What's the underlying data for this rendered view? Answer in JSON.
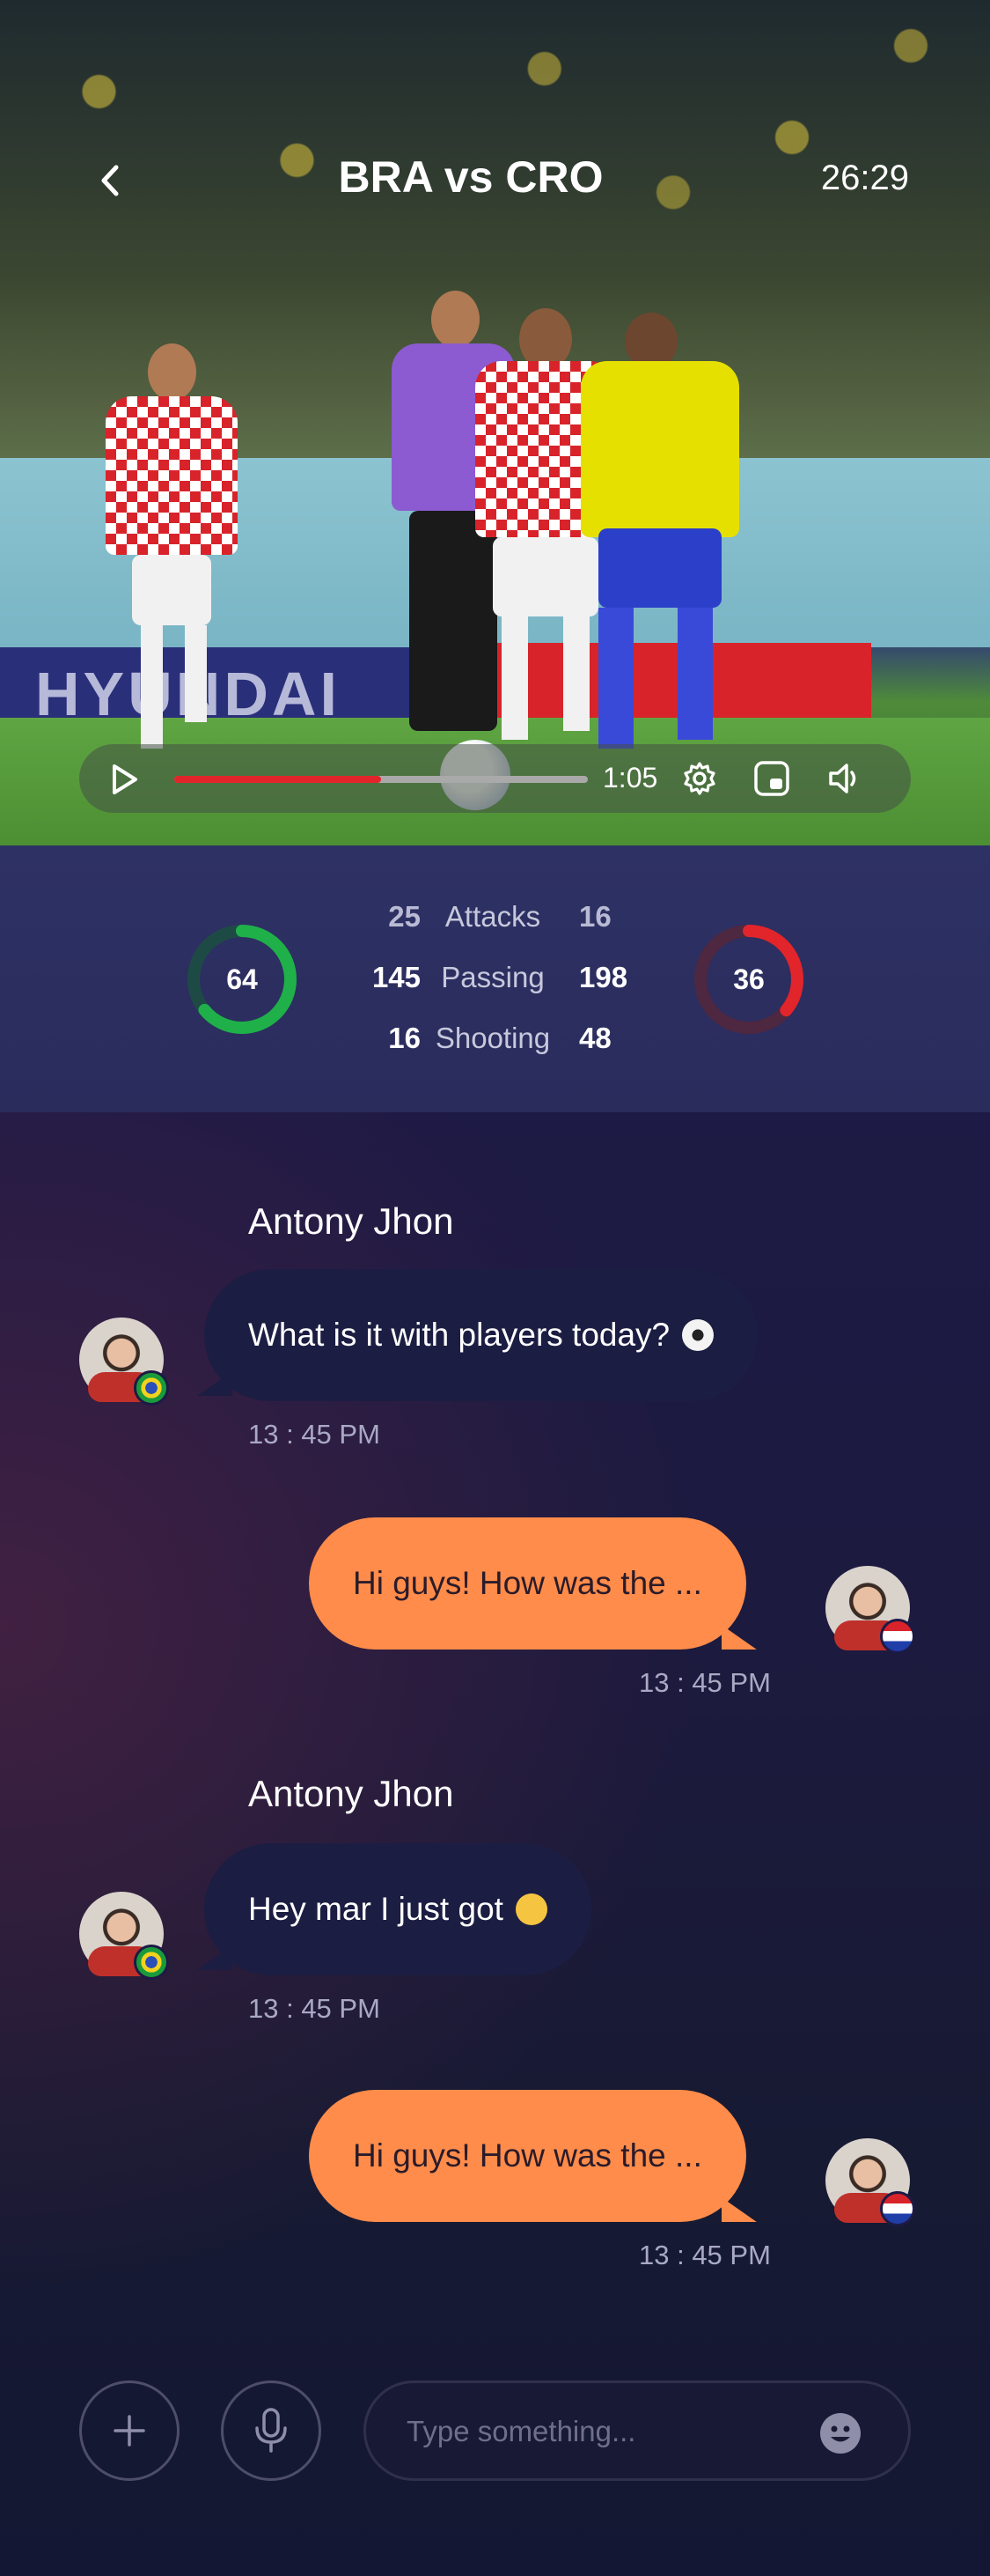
{
  "header": {
    "title": "BRA vs CRO",
    "clock": "26:29"
  },
  "video": {
    "ad_text": "HYUNDAI",
    "time": "1:05",
    "progress": 0.5,
    "colors": {
      "progress_fill": "#e1252b",
      "progress_track": "#a9a9a9"
    }
  },
  "stats": {
    "left_possession": "64",
    "right_possession": "36",
    "left_possession_fraction": 0.64,
    "right_possession_fraction": 0.36,
    "rows": [
      {
        "left": "25",
        "label": "Attacks",
        "right": "16"
      },
      {
        "left": "145",
        "label": "Passing",
        "right": "198"
      },
      {
        "left": "16",
        "label": "Shooting",
        "right": "48"
      }
    ],
    "colors": {
      "left_ring": "#1fb04a",
      "right_ring": "#e1252b"
    }
  },
  "chat": {
    "messages": [
      {
        "direction": "in",
        "sender": "Antony Jhon",
        "text": "What is it with players today?",
        "emoji": "soccer-ball",
        "time": "13 : 45 PM",
        "flag": "brazil"
      },
      {
        "direction": "out",
        "text": "Hi guys! How was the ...",
        "time": "13 : 45 PM",
        "flag": "croatia"
      },
      {
        "direction": "in",
        "sender": "Antony Jhon",
        "text": "Hey mar I just got",
        "emoji": "zany-face",
        "time": "13 : 45 PM",
        "flag": "brazil"
      },
      {
        "direction": "out",
        "text": "Hi guys! How was the ...",
        "time": "13 : 45 PM",
        "flag": "croatia"
      }
    ],
    "colors": {
      "outgoing_bubble": "#ff8c4a",
      "incoming_bubble": "#1c1d42"
    }
  },
  "composer": {
    "placeholder": "Type something...",
    "icons": [
      "plus-icon",
      "microphone-icon",
      "emoji-icon"
    ]
  }
}
